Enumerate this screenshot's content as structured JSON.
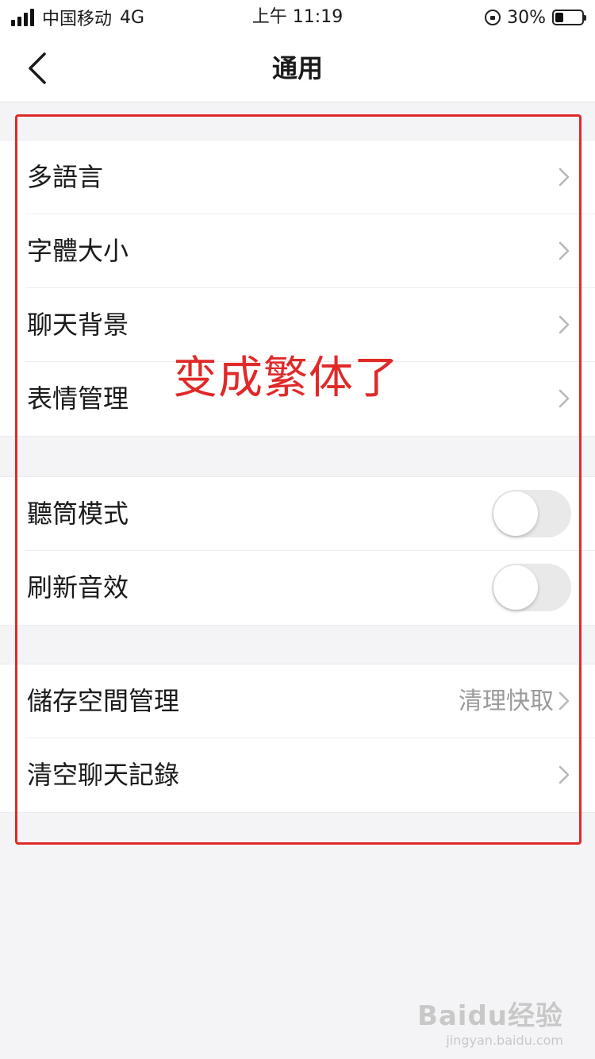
{
  "status_bar": {
    "carrier": "中国移动",
    "network": "4G",
    "time": "上午 11:19",
    "battery_percent": "30%",
    "battery_level": 0.3
  },
  "nav": {
    "title": "通用",
    "back_icon": "chevron-left-icon"
  },
  "groups": [
    {
      "rows": [
        {
          "label": "多語言",
          "type": "link"
        },
        {
          "label": "字體大小",
          "type": "link"
        },
        {
          "label": "聊天背景",
          "type": "link"
        },
        {
          "label": "表情管理",
          "type": "link"
        }
      ]
    },
    {
      "rows": [
        {
          "label": "聽筒模式",
          "type": "toggle",
          "on": false
        },
        {
          "label": "刷新音效",
          "type": "toggle",
          "on": false
        }
      ]
    },
    {
      "rows": [
        {
          "label": "儲存空間管理",
          "type": "link",
          "value": "清理快取"
        },
        {
          "label": "清空聊天記錄",
          "type": "link"
        }
      ]
    }
  ],
  "annotation": {
    "text": "变成繁体了",
    "color": "#e02a2a"
  },
  "watermark": {
    "main": "Baidu经验",
    "sub": "jingyan.baidu.com"
  }
}
